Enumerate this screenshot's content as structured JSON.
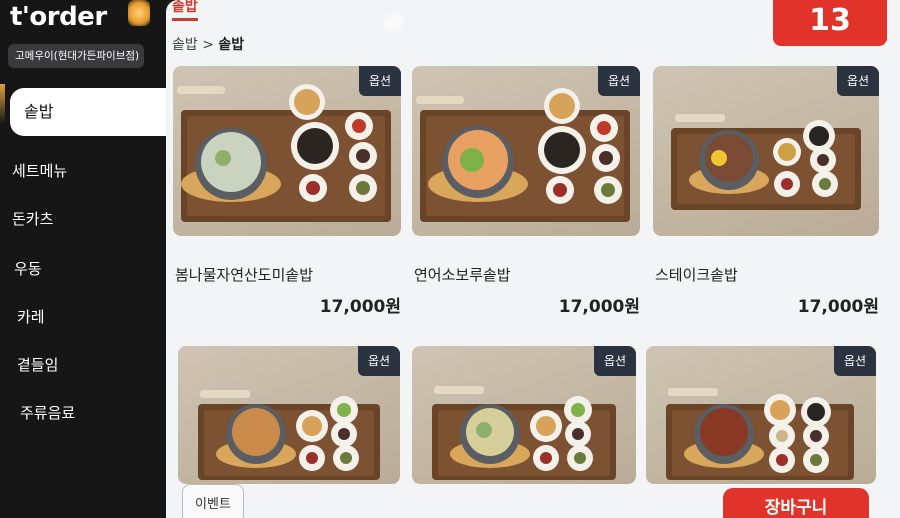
{
  "brand": {
    "logo_text": "t'order",
    "store_name": "고메우이(현대가든파이브점)"
  },
  "categories": [
    "솥밥",
    "세트메뉴",
    "돈카츠",
    "우동",
    "카레",
    "곁들임",
    "주류음료"
  ],
  "active_category": "솥밥",
  "top_tab": "솥밥",
  "breadcrumb": {
    "parent": "솥밥",
    "separator": ">",
    "current": "솥밥"
  },
  "table_number": "13",
  "menu_items": [
    {
      "name": "봄나물자연산도미솥밥",
      "price": "17,000원",
      "badge": "옵션"
    },
    {
      "name": "연어소보루솥밥",
      "price": "17,000원",
      "badge": "옵션"
    },
    {
      "name": "스테이크솥밥",
      "price": "17,000원",
      "badge": "옵션"
    },
    {
      "name": "",
      "price": "",
      "badge": "옵션"
    },
    {
      "name": "",
      "price": "",
      "badge": "옵션"
    },
    {
      "name": "",
      "price": "",
      "badge": "옵션"
    }
  ],
  "event_button": "이벤트",
  "cart_button": "장바구니",
  "colors": {
    "accent": "#e2332a",
    "badge": "#2b3340",
    "sidebar": "#161617",
    "panel": "#f3f4f6"
  }
}
